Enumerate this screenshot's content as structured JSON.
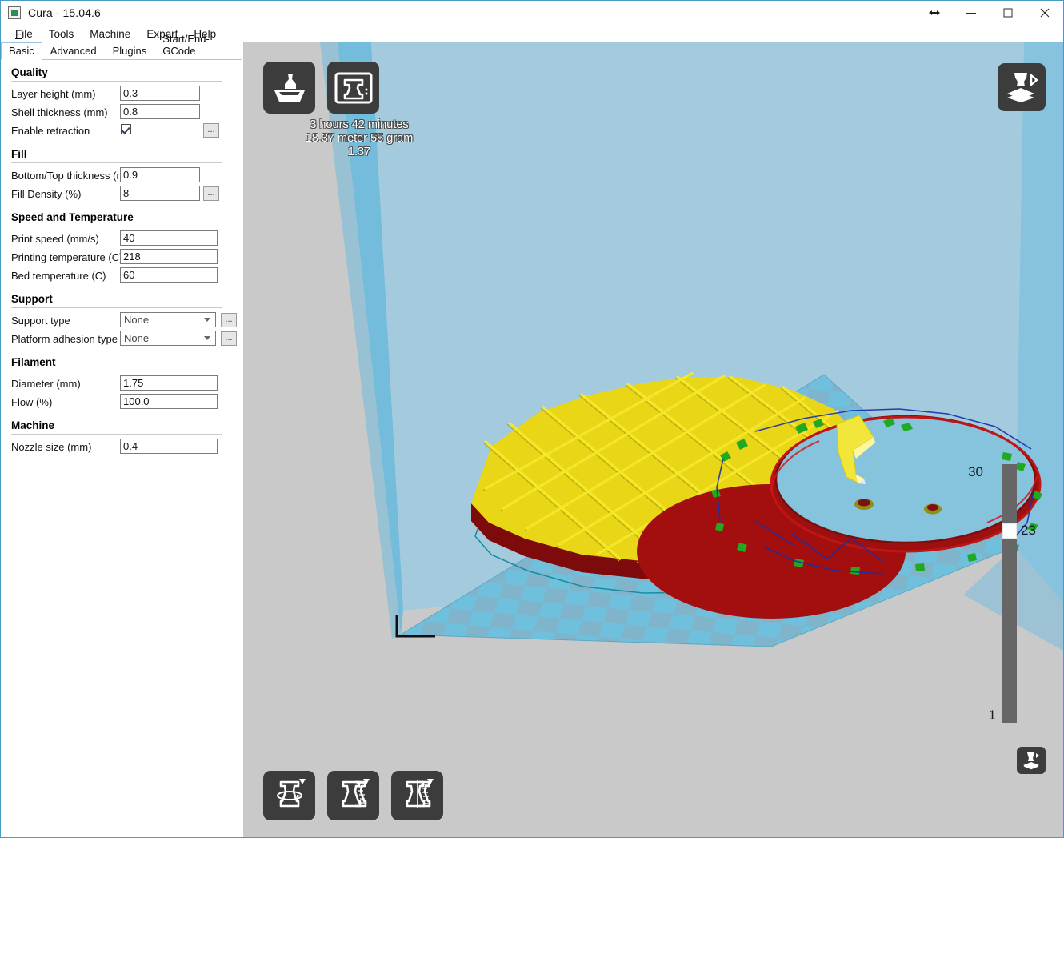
{
  "window": {
    "title": "Cura - 15.04.6",
    "icon": "app-icon",
    "controls": {
      "resize_label": "↔",
      "minimize_label": "—",
      "maximize_label": "□",
      "close_label": "✕"
    }
  },
  "menubar": {
    "items": [
      {
        "label": "File",
        "mnemonic": "F"
      },
      {
        "label": "Tools",
        "mnemonic": ""
      },
      {
        "label": "Machine",
        "mnemonic": ""
      },
      {
        "label": "Expert",
        "mnemonic": ""
      },
      {
        "label": "Help",
        "mnemonic": ""
      }
    ]
  },
  "tabs": {
    "active": "Basic",
    "items": [
      {
        "label": "Basic"
      },
      {
        "label": "Advanced"
      },
      {
        "label": "Plugins"
      },
      {
        "label": "Start/End-GCode"
      }
    ]
  },
  "settings": {
    "groups": [
      {
        "title": "Quality",
        "rows": [
          {
            "label": "Layer height (mm)",
            "type": "text",
            "value": "0.3"
          },
          {
            "label": "Shell thickness (mm)",
            "type": "text",
            "value": "0.8"
          },
          {
            "label": "Enable retraction",
            "type": "checkbox",
            "checked": true,
            "dots": "..."
          }
        ]
      },
      {
        "title": "Fill",
        "rows": [
          {
            "label": "Bottom/Top thickness (mm)",
            "type": "text",
            "value": "0.9"
          },
          {
            "label": "Fill Density (%)",
            "type": "text",
            "value": "8",
            "dots": "..."
          }
        ]
      },
      {
        "title": "Speed and Temperature",
        "rows": [
          {
            "label": "Print speed (mm/s)",
            "type": "text",
            "value": "40"
          },
          {
            "label": "Printing temperature (C)",
            "type": "text",
            "value": "218"
          },
          {
            "label": "Bed temperature (C)",
            "type": "text",
            "value": "60"
          }
        ]
      },
      {
        "title": "Support",
        "rows": [
          {
            "label": "Support type",
            "type": "select",
            "value": "None",
            "dots": "..."
          },
          {
            "label": "Platform adhesion type",
            "type": "select",
            "value": "None",
            "dots": "..."
          }
        ]
      },
      {
        "title": "Filament",
        "rows": [
          {
            "label": "Diameter (mm)",
            "type": "text",
            "value": "1.75"
          },
          {
            "label": "Flow (%)",
            "type": "text",
            "value": "100.0"
          }
        ]
      },
      {
        "title": "Machine",
        "rows": [
          {
            "label": "Nozzle size (mm)",
            "type": "text",
            "value": "0.4"
          }
        ]
      }
    ]
  },
  "viewport": {
    "print_info": {
      "line1": "3 hours 42 minutes",
      "line2": "18.37 meter 55 gram",
      "line3": "1.37"
    },
    "toolbar_top": [
      {
        "name": "load-model-button",
        "icon": "load-model-icon"
      },
      {
        "name": "print-button",
        "icon": "print-icon"
      }
    ],
    "toolbar_bottom": [
      {
        "name": "rotate-button",
        "icon": "rotate-icon"
      },
      {
        "name": "scale-button",
        "icon": "scale-icon"
      },
      {
        "name": "mirror-button",
        "icon": "mirror-icon"
      }
    ],
    "view_mode_button": {
      "name": "view-mode-button",
      "icon": "layers-view-icon"
    },
    "expert_button": {
      "name": "expert-open-button",
      "icon": "model-on-platform-icon"
    },
    "layer_slider": {
      "top_label": "30",
      "current_label": "23",
      "bottom_label": "1",
      "max": 30,
      "min": 1,
      "value": 23
    },
    "colors": {
      "background": "#c9c9c9",
      "back_wall": "#a4cbdd",
      "left_wall": "#6fbcdd",
      "right_wall": "#8cc6e0",
      "platform_light": "#6fc0dd",
      "platform_dark": "#7fb4cb",
      "gcode_infill": "#f2e513",
      "gcode_perimeter": "#b41010",
      "gcode_support": "#22aa22",
      "gcode_move": "#1a2ea8",
      "gcode_skirt": "#1c8b9e"
    }
  }
}
